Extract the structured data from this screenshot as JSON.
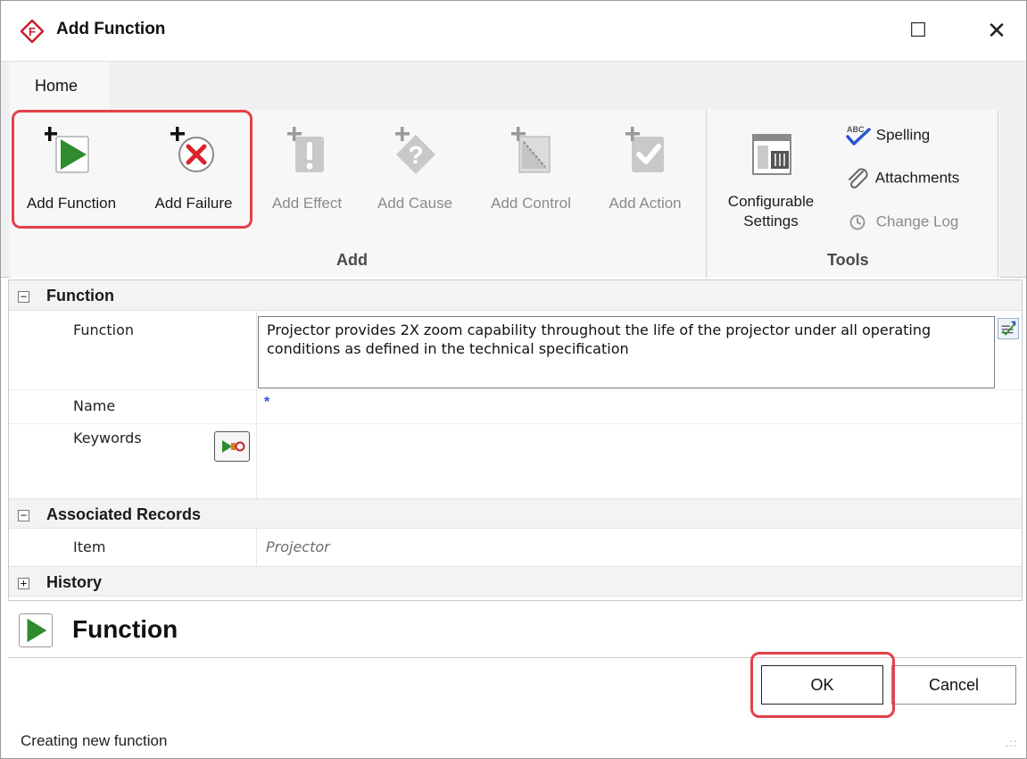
{
  "window": {
    "title": "Add Function",
    "maximize_glyph": "☐",
    "close_glyph": "✕"
  },
  "ribbon": {
    "tabs": [
      {
        "label": "Home"
      }
    ],
    "groups": [
      {
        "label": "Add",
        "buttons": [
          {
            "label": "Add Function",
            "icon": "add-function-icon",
            "enabled": true
          },
          {
            "label": "Add Failure",
            "icon": "add-failure-icon",
            "enabled": true
          },
          {
            "label": "Add Effect",
            "icon": "add-effect-icon",
            "enabled": false
          },
          {
            "label": "Add Cause",
            "icon": "add-cause-icon",
            "enabled": false
          },
          {
            "label": "Add Control",
            "icon": "add-control-icon",
            "enabled": false
          },
          {
            "label": "Add Action",
            "icon": "add-action-icon",
            "enabled": false
          }
        ]
      },
      {
        "label": "Tools",
        "buttons": [
          {
            "label_line1": "Configurable",
            "label_line2": "Settings",
            "icon": "configurable-settings-icon",
            "enabled": true
          },
          {
            "label": "Spelling",
            "icon": "spelling-icon",
            "enabled": true
          },
          {
            "label": "Attachments",
            "icon": "attachments-icon",
            "enabled": true
          },
          {
            "label": "Change Log",
            "icon": "change-log-icon",
            "enabled": false
          }
        ]
      }
    ],
    "highlight_color": "#e5404a"
  },
  "properties": {
    "sections": [
      {
        "title": "Function",
        "expanded": true,
        "fields": [
          {
            "label": "Function",
            "value": "Projector provides 2X zoom capability throughout the life of the projector under all operating conditions as defined in the technical specification"
          },
          {
            "label": "Name",
            "value": "*"
          },
          {
            "label": "Keywords",
            "value": ""
          }
        ]
      },
      {
        "title": "Associated Records",
        "expanded": true,
        "fields": [
          {
            "label": "Item",
            "value": "Projector"
          }
        ]
      },
      {
        "title": "History",
        "expanded": false,
        "fields": []
      }
    ],
    "collapse_glyph": "−",
    "expand_glyph": "+"
  },
  "record_header": {
    "title": "Function",
    "icon": "function-play-icon"
  },
  "buttons": {
    "ok": "OK",
    "cancel": "Cancel"
  },
  "status": {
    "text": "Creating new function"
  },
  "colors": {
    "function_green": "#2e8b2e",
    "failure_red": "#d9232d",
    "accent_blue": "#2a55d4"
  }
}
